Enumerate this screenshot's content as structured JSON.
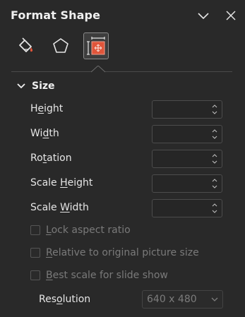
{
  "panel": {
    "title": "Format Shape",
    "header_icons": [
      "chevron-down-icon",
      "close-icon"
    ]
  },
  "tabs": [
    {
      "name": "Fill & Line",
      "icon": "paint-bucket-icon",
      "selected": false
    },
    {
      "name": "Effects",
      "icon": "pentagon-icon",
      "selected": false
    },
    {
      "name": "Size & Properties",
      "icon": "size-properties-icon",
      "selected": true
    }
  ],
  "size_section": {
    "label": "Size",
    "expanded": true,
    "fields": [
      {
        "pre": "H",
        "acc": "e",
        "post": "ight",
        "value": ""
      },
      {
        "pre": "Wi",
        "acc": "d",
        "post": "th",
        "value": ""
      },
      {
        "pre": "Ro",
        "acc": "t",
        "post": "ation",
        "value": ""
      },
      {
        "pre": "Scale ",
        "acc": "H",
        "post": "eight",
        "value": ""
      },
      {
        "pre": "Scale ",
        "acc": "W",
        "post": "idth",
        "value": ""
      }
    ],
    "checkboxes": [
      {
        "pre": "",
        "acc": "L",
        "post": "ock aspect ratio",
        "checked": false,
        "enabled": false
      },
      {
        "pre": "",
        "acc": "R",
        "post": "elative to original picture size",
        "checked": false,
        "enabled": false
      },
      {
        "pre": "",
        "acc": "B",
        "post": "est scale for slide show",
        "checked": false,
        "enabled": false
      }
    ],
    "resolution": {
      "pre": "Res",
      "acc": "o",
      "post": "lution",
      "value": "640 x 480"
    }
  },
  "colors": {
    "background": "#292929",
    "accent_red": "#e0553a",
    "text": "#e6e6e6",
    "disabled_text": "#7a7a7a"
  }
}
